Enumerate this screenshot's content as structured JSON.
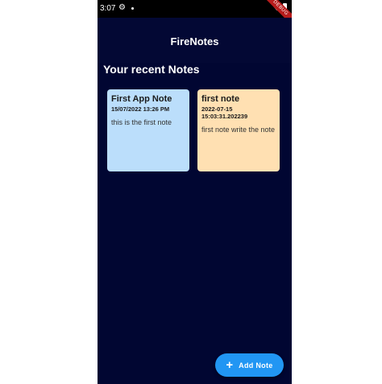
{
  "status_bar": {
    "time": "3:07",
    "icons": [
      "gear-icon",
      "notification-dot-icon",
      "wifi-icon",
      "battery-icon"
    ],
    "debug_banner": "DEBUG"
  },
  "app_bar": {
    "title": "FireNotes"
  },
  "section": {
    "title": "Your recent Notes"
  },
  "notes": [
    {
      "title": "First App Note",
      "date": "15/07/2022 13:26 PM",
      "body": "this is the first note",
      "color": "#bbdefb"
    },
    {
      "title": "first note",
      "date": "2022-07-15 15:03:31.202239",
      "body": "first note write the note",
      "color": "#ffe0b2"
    }
  ],
  "fab": {
    "icon": "plus-icon",
    "label": "Add Note",
    "color": "#2196f3"
  },
  "colors": {
    "background": "#010632",
    "status_bar": "#000000"
  }
}
